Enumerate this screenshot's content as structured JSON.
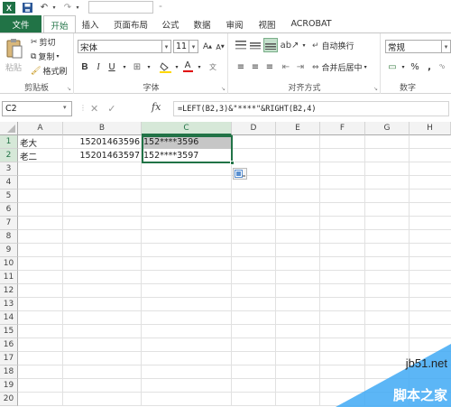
{
  "formula_bar": {
    "name_box": "C2",
    "fx_label": "fx",
    "formula": "=LEFT(B2,3)&\"****\"&RIGHT(B2,4)"
  },
  "ribbon": {
    "tabs": [
      "文件",
      "开始",
      "插入",
      "页面布局",
      "公式",
      "数据",
      "审阅",
      "视图",
      "ACROBAT"
    ],
    "clipboard": {
      "paste": "粘贴",
      "cut": "剪切",
      "copy": "复制",
      "format_painter": "格式刷",
      "label": "剪贴板"
    },
    "font": {
      "name": "宋体",
      "size": "11",
      "bold": "B",
      "italic": "I",
      "underline": "U",
      "label": "字体"
    },
    "alignment": {
      "wrap": "自动换行",
      "merge": "合并后居中",
      "label": "对齐方式"
    },
    "number": {
      "format": "常规",
      "percent": "%",
      "comma": ",",
      "label": "数字"
    }
  },
  "columns": [
    "A",
    "B",
    "C",
    "D",
    "E",
    "F",
    "G",
    "H"
  ],
  "rows": [
    "1",
    "2",
    "3",
    "4",
    "5",
    "6",
    "7",
    "8",
    "9",
    "10",
    "11",
    "12",
    "13",
    "14",
    "15",
    "16",
    "17",
    "18",
    "19",
    "20"
  ],
  "cells": {
    "A1": "老大",
    "B1": "15201463596",
    "C1": "152****3596",
    "A2": "老二",
    "B2": "15201463597",
    "C2": "152****3597"
  },
  "watermark": {
    "url": "jb51.net",
    "text": "脚本之家"
  },
  "colors": {
    "accent": "#217346",
    "selection_fill": "#c6c6c6"
  }
}
